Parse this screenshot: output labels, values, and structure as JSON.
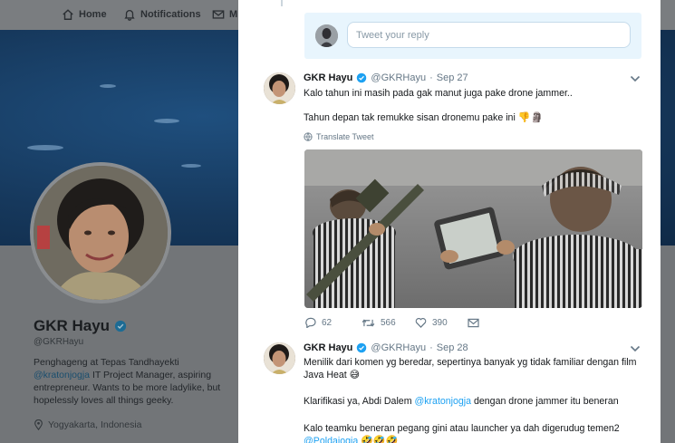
{
  "nav": {
    "home_label": "Home",
    "notifications_label": "Notifications",
    "messages_label": "M"
  },
  "profile": {
    "name": "GKR Hayu",
    "handle": "@GKRHayu",
    "bio_line1": "Penghageng at Tepas Tandhayekti",
    "bio_mention": "@kratonjogja",
    "bio_line2_rest": " IT Project Manager, aspiring",
    "bio_line3": "entrepreneur. Wants to be more ladylike, but",
    "bio_line4": "hopelessly loves all things geeky.",
    "location": "Yogyakarta, Indonesia"
  },
  "reply": {
    "placeholder": "Tweet your reply"
  },
  "tweets": [
    {
      "name": "GKR Hayu",
      "handle": "@GKRHayu",
      "dot": "·",
      "date": "Sep 27",
      "line1": "Kalo tahun ini masih pada gak manut juga pake drone jammer..",
      "line2": "Tahun depan tak remukke sisan dronemu pake ini",
      "translate_label": "Translate Tweet",
      "replies": "62",
      "retweets": "566",
      "likes": "390"
    },
    {
      "name": "GKR Hayu",
      "handle": "@GKRHayu",
      "dot": "·",
      "date": "Sep 28",
      "line1": "Menilik dari komen yg beredar, sepertinya banyak yg tidak familiar dengan film",
      "line2": "Java Heat",
      "line3_a": "Klarifikasi ya, Abdi Dalem ",
      "line3_mention": "@kratonjogja",
      "line3_b": " dengan drone jammer itu beneran",
      "line4": "Kalo teamku beneran pegang gini atau launcher ya dah digerudug temen2",
      "line5_mention": "@Poldajogja"
    }
  ],
  "colors": {
    "accent": "#1da1f2",
    "text": "#14171a",
    "muted": "#657786",
    "reply_bg": "#e8f5fd",
    "verified": "#1da1f2"
  },
  "icons": {
    "home": "home-icon",
    "notifications": "bell-icon",
    "messages": "mail-icon",
    "verified": "verified-badge-icon",
    "caret": "chevron-down-icon",
    "globe": "globe-icon",
    "reply": "reply-icon",
    "retweet": "retweet-icon",
    "like": "heart-icon",
    "dm": "envelope-icon",
    "location": "location-pin-icon"
  }
}
